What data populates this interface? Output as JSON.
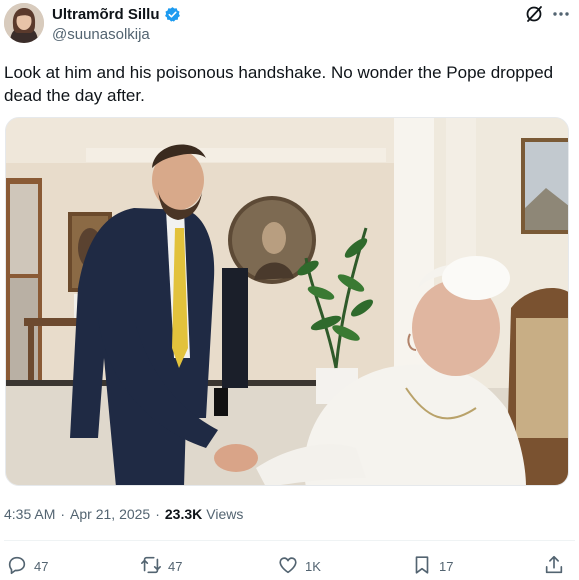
{
  "author": {
    "display_name": "Ultramõrd Sillu",
    "handle": "@suunasolkija",
    "verified": true
  },
  "tweet": {
    "text": "Look at him and his poisonous handshake. No wonder the Pope dropped dead the day after.",
    "time": "4:35 AM",
    "date": "Apr 21, 2025",
    "views_count": "23.3K",
    "views_label": "Views"
  },
  "actions": {
    "reply_count": "47",
    "repost_count": "47",
    "like_count": "1K",
    "bookmark_count": "17"
  },
  "icons": {
    "verified": "verified-badge-icon",
    "grok": "grok-icon",
    "more": "more-icon",
    "reply": "reply-icon",
    "repost": "repost-icon",
    "like": "like-icon",
    "bookmark": "bookmark-icon",
    "share": "share-icon"
  },
  "colors": {
    "text": "#0f1419",
    "secondary": "#536471",
    "verified": "#1d9bf0"
  }
}
